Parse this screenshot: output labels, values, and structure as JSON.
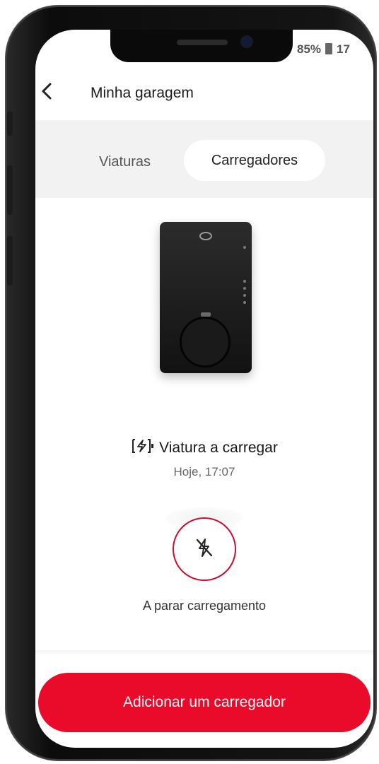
{
  "status_bar": {
    "battery": "85%",
    "time": "17"
  },
  "header": {
    "back_icon": "chevron-left-icon",
    "title": "Minha garagem"
  },
  "tabs": [
    {
      "label": "Viaturas",
      "active": false
    },
    {
      "label": "Carregadores",
      "active": true
    }
  ],
  "charger": {
    "image": "wallbox-charger",
    "status_icon": "battery-charging-icon",
    "status": "Viatura a carregar",
    "time": "Hoje, 17:07"
  },
  "action": {
    "icon": "lightning-off-icon",
    "label": "A parar carregamento"
  },
  "primary_button": {
    "label": "Adicionar um carregador"
  },
  "colors": {
    "accent": "#ea0a2a",
    "ring": "#c8102e",
    "tabbar_bg": "#f2f2f2"
  }
}
